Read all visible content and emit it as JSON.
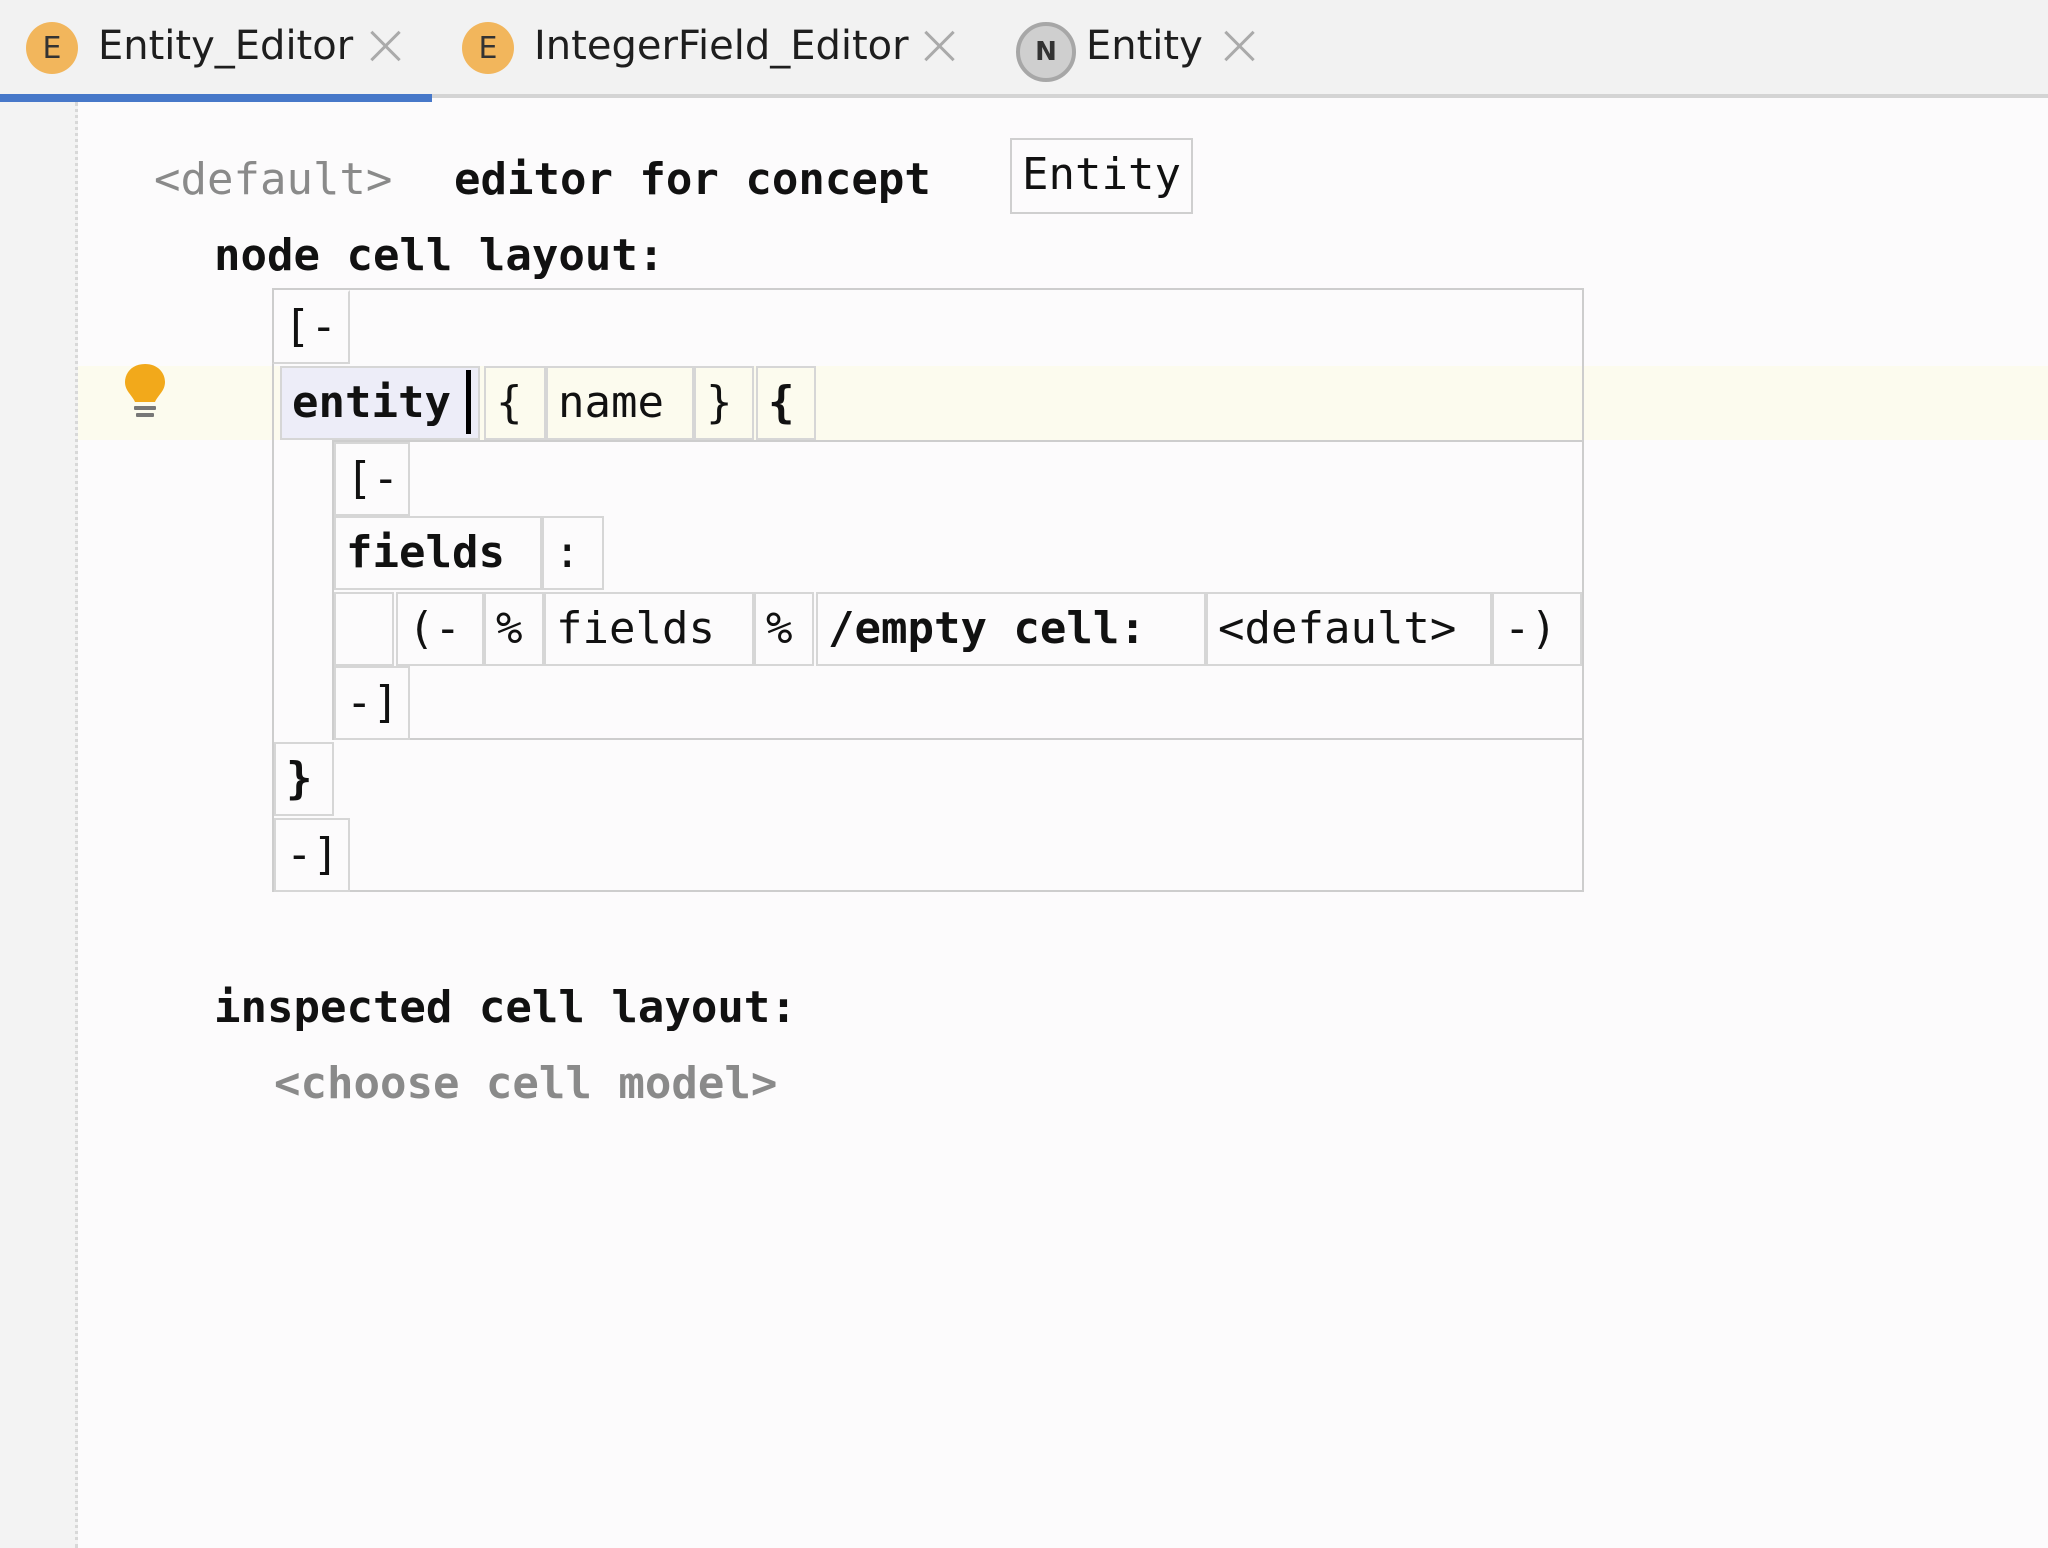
{
  "tabs": [
    {
      "label": "Entity_Editor",
      "icon_letter": "E",
      "icon": "concept-icon",
      "active": true
    },
    {
      "label": "IntegerField_Editor",
      "icon_letter": "E",
      "icon": "concept-icon",
      "active": false
    },
    {
      "label": "Entity",
      "icon_letter": "N",
      "icon": "node-icon",
      "active": false
    }
  ],
  "editor": {
    "header": {
      "default_tag": "<default>",
      "editor_for_concept": "editor for concept",
      "concept_name": "Entity"
    },
    "node_cell_layout_label": "node cell layout:",
    "cells": {
      "outer_open": "[-",
      "entity_keyword": "entity",
      "lbrace1": "{",
      "name_ref": "name",
      "rbrace1": "}",
      "lbrace2": "{",
      "inner_open": "[-",
      "fields_label": "fields",
      "colon": ":",
      "collection_open": "(-",
      "percent1": "%",
      "fields_ref": "fields",
      "percent2": "%",
      "empty_cell_label": "/empty cell:",
      "empty_cell_value": "<default>",
      "collection_close": "-)",
      "inner_close": "-]",
      "rbrace_final": "}",
      "outer_close": "-]"
    },
    "inspected_cell_layout_label": "inspected cell layout:",
    "choose_cell_model": "<choose cell model>"
  },
  "colors": {
    "accent_tab_underline": "#4778c9",
    "concept_icon": "#f2b65c",
    "concept_name": "#8a1f9e",
    "intention_bulb": "#f2a91b",
    "line_highlight": "#fcfbee"
  }
}
